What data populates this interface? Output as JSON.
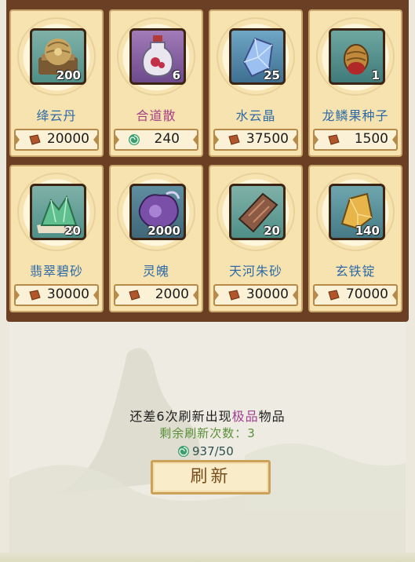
{
  "items": [
    {
      "name": "绛云丹",
      "qty": "200",
      "price": "20000",
      "currency": "copper",
      "name_color": "blue",
      "icon": "pill-jar-icon"
    },
    {
      "name": "合道散",
      "qty": "6",
      "price": "240",
      "currency": "swirl",
      "name_color": "purple",
      "icon": "potion-bottle-icon"
    },
    {
      "name": "水云晶",
      "qty": "25",
      "price": "37500",
      "currency": "copper",
      "name_color": "blue",
      "icon": "crystal-icon"
    },
    {
      "name": "龙鳞果种子",
      "qty": "1",
      "price": "1500",
      "currency": "copper",
      "name_color": "blue",
      "icon": "seed-icon"
    },
    {
      "name": "翡翠碧砂",
      "qty": "20",
      "price": "30000",
      "currency": "copper",
      "name_color": "blue",
      "icon": "jade-sand-icon"
    },
    {
      "name": "灵魄",
      "qty": "2000",
      "price": "2000",
      "currency": "copper",
      "name_color": "blue",
      "icon": "spirit-orb-icon"
    },
    {
      "name": "天河朱砂",
      "qty": "20",
      "price": "30000",
      "currency": "copper",
      "name_color": "blue",
      "icon": "cinnabar-ore-icon"
    },
    {
      "name": "玄铁锭",
      "qty": "140",
      "price": "70000",
      "currency": "copper",
      "name_color": "blue",
      "icon": "iron-ingot-icon"
    }
  ],
  "hint": {
    "prefix": "还差6次刷新出现",
    "highlight": "极品",
    "suffix": "物品"
  },
  "refresh_count_label": "剩余刷新次数：3",
  "currency_balance": "937/50",
  "refresh_button": "刷新",
  "colors": {
    "frame": "#6b3f24",
    "card": "#f6e3b0",
    "blue_name": "#2e6aa6",
    "purple_name": "#a63f87",
    "highlight": "#a03f92",
    "count_text": "#5b8f3a"
  }
}
